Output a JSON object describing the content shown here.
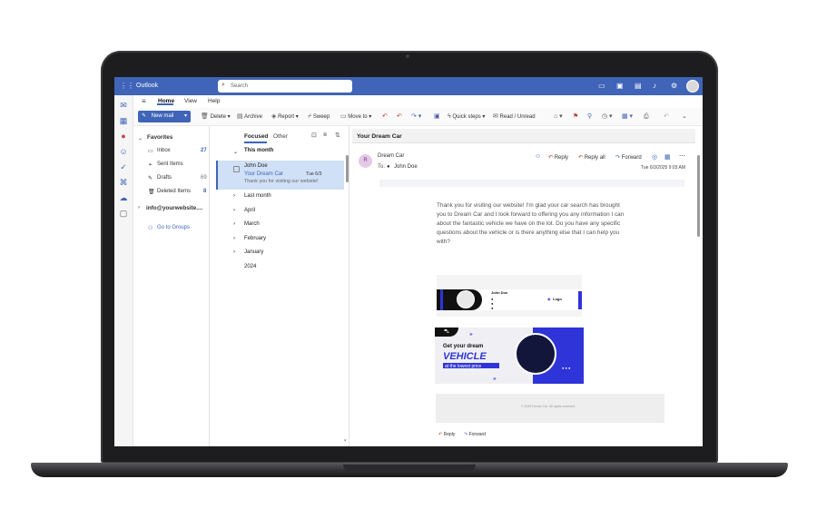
{
  "app": {
    "name": "Outlook",
    "search_placeholder": "Search"
  },
  "menu": {
    "tabs": [
      "Home",
      "View",
      "Help"
    ]
  },
  "ribbon": {
    "new_mail": "New mail",
    "delete": "Delete",
    "archive": "Archive",
    "report": "Report",
    "sweep": "Sweep",
    "move_to": "Move to",
    "quick_steps": "Quick steps",
    "read_unread": "Read / Unread"
  },
  "folders": {
    "favorites": "Favorites",
    "items": [
      {
        "label": "Inbox",
        "count": "27"
      },
      {
        "label": "Sent Items",
        "count": ""
      },
      {
        "label": "Drafts",
        "count": "69"
      },
      {
        "label": "Deleted Items",
        "count": "8"
      }
    ],
    "account": "info@yourwebsite....",
    "groups": "Go to Groups"
  },
  "message_list": {
    "tab_focused": "Focused",
    "tab_other": "Other",
    "this_month": "This month",
    "selected": {
      "sender": "John Doe",
      "subject": "Your Dream Car",
      "date": "Tue 6/3",
      "preview": "Thank you for visiting our website!"
    },
    "groups": [
      "Last month",
      "April",
      "March",
      "February",
      "January",
      "2024"
    ]
  },
  "reading": {
    "subject": "Your Dream Car",
    "avatar_letter": "R",
    "sender": "Dream Car",
    "to_label": "To:",
    "to_name": "John Doe",
    "reply": "Reply",
    "reply_all": "Reply all",
    "forward": "Forward",
    "timestamp": "Tue 6/3/2025 9:03 AM",
    "body": "Thank you for visiting our website! I'm glad your car search has brought you to Dream Car and I look forward to offering you any information I can about the fantastic vehicle we have on the lot. Do you have any specific questions about the vehicle or is there anything else that I can help you with?",
    "signature": {
      "name": "John Doe",
      "logo": "Logo"
    },
    "banner": {
      "line1": "Get your dream",
      "line2": "VEHICLE",
      "line3": "at the lowest price"
    },
    "footer_text": "© 2025 Dream Car. All rights reserved.",
    "bottom_reply": "Reply",
    "bottom_forward": "Forward"
  },
  "colors": {
    "brand": "#3f64b8",
    "selected": "#cfe0f7",
    "accent_blue": "#2f34d8"
  }
}
